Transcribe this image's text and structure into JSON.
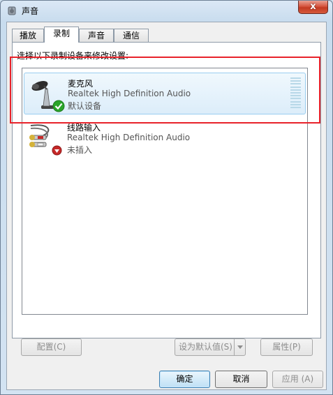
{
  "window": {
    "title": "声音",
    "close_glyph": "x"
  },
  "tabs": [
    {
      "label": "播放",
      "active": false
    },
    {
      "label": "录制",
      "active": true
    },
    {
      "label": "声音",
      "active": false
    },
    {
      "label": "通信",
      "active": false
    }
  ],
  "instructions": "选择以下录制设备来修改设置:",
  "devices": [
    {
      "name": "麦克风",
      "driver": "Realtek High Definition Audio",
      "status": "默认设备",
      "icon": "microphone-icon",
      "badge": "default-check-icon",
      "selected": true
    },
    {
      "name": "线路输入",
      "driver": "Realtek High Definition Audio",
      "status": "未插入",
      "icon": "line-in-icon",
      "badge": "unplugged-icon",
      "selected": false
    }
  ],
  "buttons": {
    "configure": "配置(C)",
    "set_default": "设为默认值(S)",
    "properties": "属性(P)",
    "ok": "确定",
    "cancel": "取消",
    "apply": "应用 (A)"
  },
  "colors": {
    "highlight_box": "#e8222a",
    "selection_border": "#99cdf0",
    "check_green": "#2aa52a",
    "unplugged_red": "#c62828"
  }
}
